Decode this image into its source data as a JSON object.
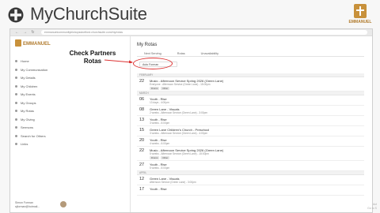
{
  "banner": {
    "brand": "MyChurchSuite",
    "badge": "EMMANUEL"
  },
  "browser": {
    "url": "emmanuelcommunitybishopsstortford.churchsuite.com/my/rotas"
  },
  "sidebar": {
    "logo": "EMMANUEL",
    "items": [
      {
        "label": "Home"
      },
      {
        "label": "My Communication"
      },
      {
        "label": "My Details"
      },
      {
        "label": "My Children"
      },
      {
        "label": "My Events"
      },
      {
        "label": "My Groups"
      },
      {
        "label": "My Rotas"
      },
      {
        "label": "My Giving"
      },
      {
        "label": "Sermons"
      },
      {
        "label": "Search for Others"
      },
      {
        "label": "Links"
      }
    ],
    "user_name": "Simon Forman",
    "user_email": "sjforman@hotmail..."
  },
  "main": {
    "title": "My Rotas",
    "tabs": [
      "Next Serving",
      "Rotas",
      "Unavailability"
    ],
    "filter_value": "Auto Forman",
    "months": [
      {
        "name": "FEBRUARY",
        "rows": [
          {
            "day": "22",
            "title": "Music - Afternoon Service Spring 2026 (Green Lane)",
            "sub": "Everyone - Afternoon Service (Green Lane) - 15:00pm",
            "tags": [
              "Drums",
              "Other"
            ]
          }
        ]
      },
      {
        "name": "MARCH",
        "rows": [
          {
            "day": "06",
            "title": "Youth - Rise",
            "sub": "13 days - 4:00pm",
            "tags": []
          },
          {
            "day": "08",
            "title": "Green Lane - Visuals",
            "sub": "2 weeks - Afternoon Service (Green Lane) - 3:00pm",
            "tags": []
          },
          {
            "day": "13",
            "title": "Youth - Rise",
            "sub": "3 weeks - 6:00pm",
            "tags": []
          },
          {
            "day": "15",
            "title": "Green Lane Children's Church - Preschool",
            "sub": "3 weeks - Afternoon Service (Green Lane) - 4:00pm",
            "tags": []
          },
          {
            "day": "20",
            "title": "Youth - Rise",
            "sub": "4 weeks - 6:00pm",
            "tags": []
          },
          {
            "day": "22",
            "title": "Music - Afternoon Service Spring 2026 (Green Lane)",
            "sub": "5 weeks - Afternoon Service (Green Lane) - 15:00pm",
            "tags": [
              "Drums",
              "Other"
            ]
          },
          {
            "day": "27",
            "title": "Youth - Rise",
            "sub": "5 weeks - 6:00pm",
            "tags": []
          }
        ]
      },
      {
        "name": "APRIL",
        "rows": [
          {
            "day": "12",
            "title": "Green Lane - Visuals",
            "sub": "Afternoon Service (Green Lane) - 3:00pm",
            "tags": []
          },
          {
            "day": "17",
            "title": "Youth - Rise",
            "sub": "",
            "tags": []
          }
        ]
      }
    ]
  },
  "annotation": {
    "line1": "Check Partners",
    "line2": "Rotas",
    "color": "#dd3333"
  },
  "watermark": {
    "line1": "Act",
    "line2": "Go to S"
  }
}
